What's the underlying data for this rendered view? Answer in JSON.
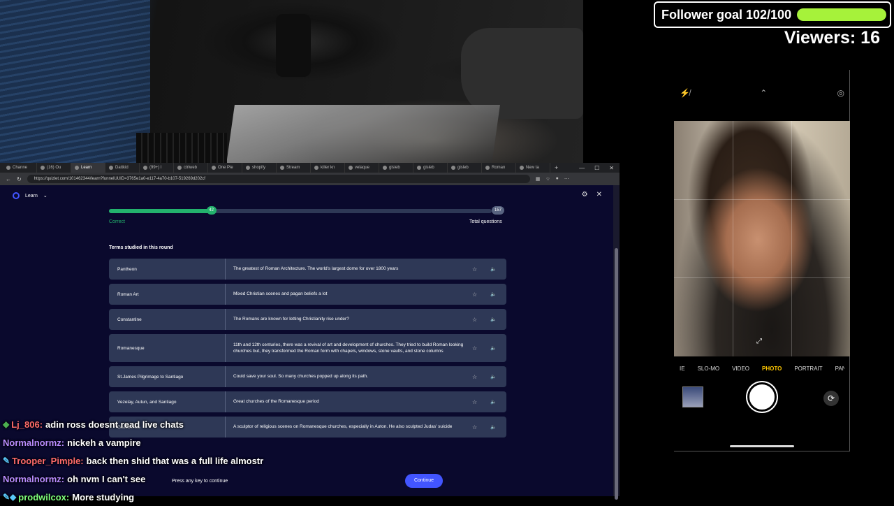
{
  "overlay": {
    "follower_goal_label": "Follower goal 102/100",
    "follower_goal_fraction": 1.0,
    "viewers_label": "Viewers: 16"
  },
  "browser": {
    "tabs": [
      "Channe",
      "(16) Ou",
      "Learn",
      "Dattkid",
      "(99+) I",
      "ctrlweb",
      "One Pie",
      "shopify",
      "Stream",
      "killer kn",
      "velaque",
      "gisleb",
      "gisleb",
      "gisleb",
      "Roman",
      "New ta"
    ],
    "active_tab_index": 2,
    "url": "https://quizlet.com/101462344/learn?funnelUUID=3765e1a0-e117-4a70-b107-519269d202cf"
  },
  "quizlet": {
    "mode_label": "Learn",
    "progress": {
      "current": "42",
      "total": "157",
      "fraction": 0.2675
    },
    "correct_label": "Correct",
    "total_label": "Total questions",
    "section_title": "Terms studied in this round",
    "terms": [
      {
        "term": "Pantheon",
        "definition": "The greatest of Roman Architecture. The world's largest dome for over 1800 years"
      },
      {
        "term": "Roman Art",
        "definition": "Mixed Christian scenes and pagan beliefs a lot"
      },
      {
        "term": "Constantine",
        "definition": "The Romans are known for letting Christianity rise under?"
      },
      {
        "term": "Romanesque",
        "definition": "11th and 12th centuries, there was a revival of art and development of churches. They tried to build Roman looking churches but, they transformed the Roman form with chapels, windows, stone vaults, and stone columns"
      },
      {
        "term": "St.James Pilgrimage to Santiago",
        "definition": "Could save your soul. So many churches popped up along its path."
      },
      {
        "term": "Vezelay, Autun, and Santiago",
        "definition": "Great churches of the Romanesque period"
      },
      {
        "term": "Gislebertus",
        "definition": "A sculptor of religious scenes on Romanesque churches, especially in Auton. He also sculpted Judas' suicide"
      }
    ],
    "footer_message": "Press any key to continue",
    "continue_label": "Continue"
  },
  "chat": [
    {
      "badge": "◆",
      "badge_color": "#4caf50",
      "user": "Lj_806:",
      "user_color": "#ff6b6b",
      "message": "adin ross doesnt read live chats"
    },
    {
      "badge": "",
      "badge_color": "",
      "user": "Normalnormz:",
      "user_color": "#b98cff",
      "message": "nickeh a vampire"
    },
    {
      "badge": "✎",
      "badge_color": "#5ac8fa",
      "user": "Trooper_Pimple:",
      "user_color": "#ff6b6b",
      "message": "back then shid that was a full life almostr"
    },
    {
      "badge": "",
      "badge_color": "",
      "user": "Normalnormz:",
      "user_color": "#b98cff",
      "message": "oh nvm I can't see"
    },
    {
      "badge": "✎◆",
      "badge_color": "#5ac8fa",
      "user": "prodwilcox:",
      "user_color": "#7fff7f",
      "message": "More studying"
    }
  ],
  "phone_camera": {
    "modes": [
      "IE",
      "SLO-MO",
      "VIDEO",
      "PHOTO",
      "PORTRAIT",
      "PANO"
    ],
    "active_mode_index": 3
  },
  "colors": {
    "quizlet_bg": "#0a092d",
    "row_bg": "#2e3856",
    "correct_green": "#23b26d",
    "continue_blue": "#4255ff",
    "goal_green": "#a6f23a"
  }
}
